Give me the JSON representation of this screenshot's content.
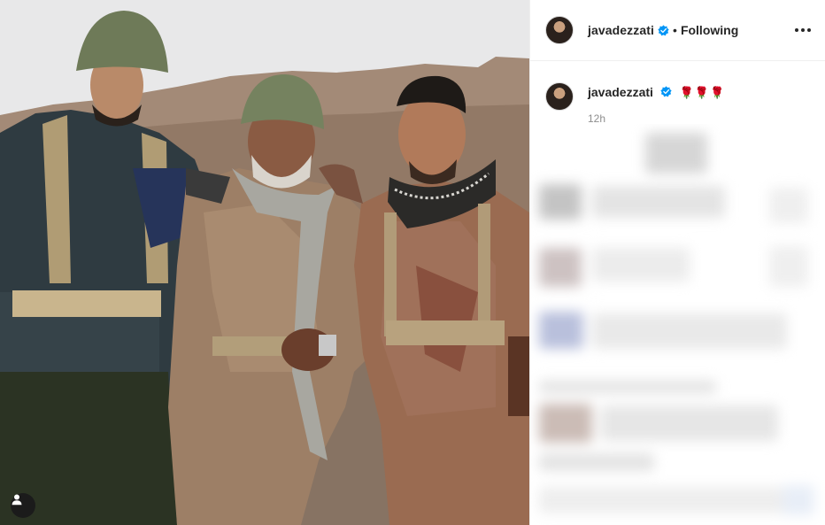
{
  "post": {
    "username": "javadezzati",
    "verified": true,
    "follow_state": "Following",
    "separator": "•",
    "caption_username": "javadezzati",
    "caption_emoji": "🌹🌹🌹",
    "timestamp": "12h"
  },
  "icons": {
    "verified": "verified-badge-icon",
    "more": "more-options-icon",
    "tags": "user-tag-icon"
  },
  "colors": {
    "verified_blue": "#0095f6",
    "text_primary": "#262626",
    "text_secondary": "#8e8e8e",
    "divider": "#efefef"
  }
}
